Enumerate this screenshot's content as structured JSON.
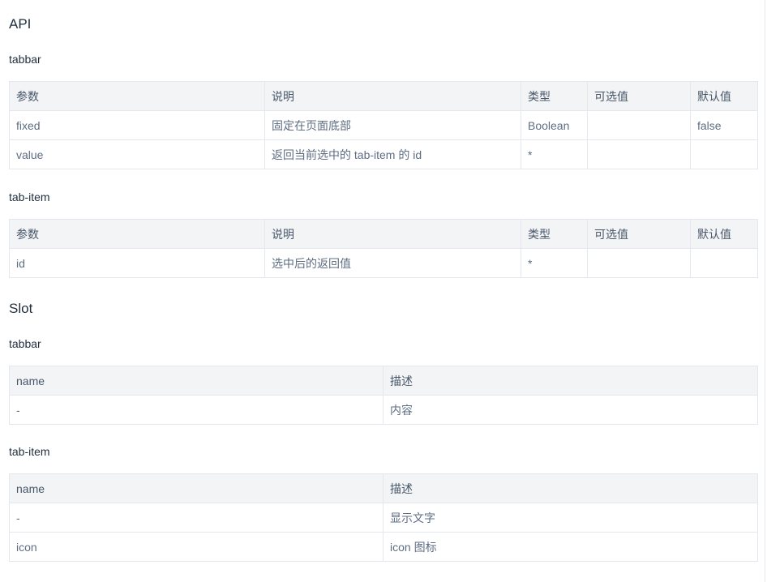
{
  "sections": {
    "api": {
      "title": "API",
      "tabbar": {
        "title": "tabbar",
        "headers": [
          "参数",
          "说明",
          "类型",
          "可选值",
          "默认值"
        ],
        "rows": [
          [
            "fixed",
            "固定在页面底部",
            "Boolean",
            "",
            "false"
          ],
          [
            "value",
            "返回当前选中的 tab-item 的 id",
            "*",
            "",
            ""
          ]
        ]
      },
      "tab_item": {
        "title": "tab-item",
        "headers": [
          "参数",
          "说明",
          "类型",
          "可选值",
          "默认值"
        ],
        "rows": [
          [
            "id",
            "选中后的返回值",
            "*",
            "",
            ""
          ]
        ]
      }
    },
    "slot": {
      "title": "Slot",
      "tabbar": {
        "title": "tabbar",
        "headers": [
          "name",
          "描述"
        ],
        "rows": [
          [
            "-",
            "内容"
          ]
        ]
      },
      "tab_item": {
        "title": "tab-item",
        "headers": [
          "name",
          "描述"
        ],
        "rows": [
          [
            "-",
            "显示文字"
          ],
          [
            "icon",
            "icon 图标"
          ]
        ]
      }
    }
  }
}
